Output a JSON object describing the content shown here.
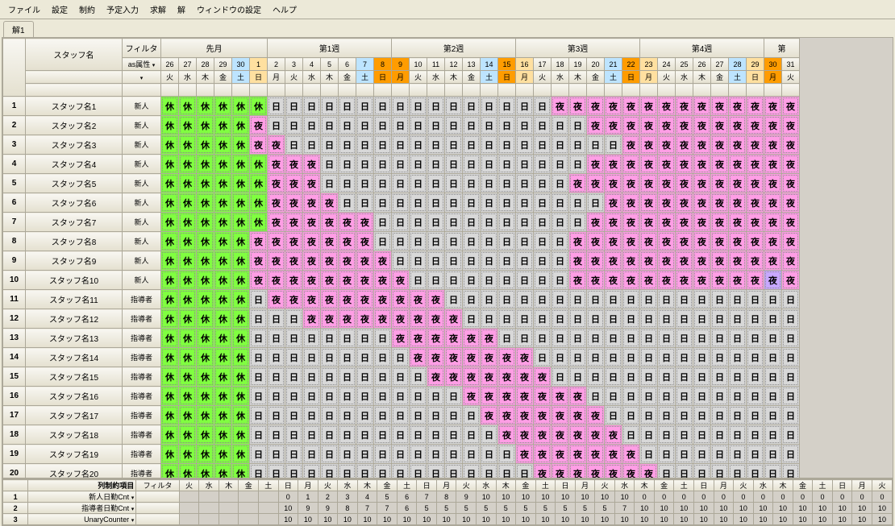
{
  "menu": [
    "ファイル",
    "設定",
    "制約",
    "予定入力",
    "求解",
    "解",
    "ウィンドウの設定",
    "ヘルプ"
  ],
  "tab_label": "解1",
  "col_staff": "スタッフ名",
  "col_filter": "フィルタ",
  "col_attr": "as属性",
  "weeks": [
    "先月",
    "第1週",
    "第2週",
    "第3週",
    "第4週",
    "第"
  ],
  "weekspans": [
    6,
    7,
    7,
    7,
    7,
    3
  ],
  "days": [
    "26",
    "27",
    "28",
    "29",
    "30",
    "1",
    "2",
    "3",
    "4",
    "5",
    "6",
    "7",
    "8",
    "9",
    "10",
    "11",
    "12",
    "13",
    "14",
    "15",
    "16",
    "17",
    "18",
    "19",
    "20",
    "21",
    "22",
    "23",
    "24",
    "25",
    "26",
    "27",
    "28",
    "29",
    "30",
    "31"
  ],
  "dow": [
    "火",
    "水",
    "木",
    "金",
    "土",
    "日",
    "月",
    "火",
    "水",
    "木",
    "金",
    "土",
    "日",
    "月",
    "火",
    "水",
    "木",
    "金",
    "土",
    "日",
    "月",
    "火",
    "水",
    "木",
    "金",
    "土",
    "日",
    "月",
    "火",
    "水",
    "木",
    "金",
    "土",
    "日",
    "月",
    "火"
  ],
  "dowc": [
    "",
    "",
    "",
    "",
    "sat",
    "sun",
    "",
    "",
    "",
    "",
    "",
    "sat",
    "or",
    "or",
    "",
    "",
    "",
    "",
    "sat",
    "or",
    "sun",
    "",
    "",
    "",
    "",
    "sat",
    "or",
    "sun",
    "",
    "",
    "",
    "",
    "sat",
    "sun",
    "or",
    ""
  ],
  "shift": {
    "h": "休",
    "n": "日",
    "y": "夜"
  },
  "staff": [
    {
      "name": "スタッフ名1",
      "attr": "新人",
      "r": "hhhhhhnnnnnnnnnnnnnnnnyyyyyyyyyyyyyy"
    },
    {
      "name": "スタッフ名2",
      "attr": "新人",
      "r": "hhhhhynnnnnnnnnnnnnnnnnnyyyyyyyyyyyy"
    },
    {
      "name": "スタッフ名3",
      "attr": "新人",
      "r": "hhhhhyynnnnnnnnnnnnnnnnnnnyyyyyyyyyy"
    },
    {
      "name": "スタッフ名4",
      "attr": "新人",
      "r": "hhhhhhyyynnnnnnnnnnnnnnnyyyyyyyyyyyy"
    },
    {
      "name": "スタッフ名5",
      "attr": "新人",
      "r": "hhhhhhyyynnnnnnnnnnnnnnyyyyyyyyyyyyy"
    },
    {
      "name": "スタッフ名6",
      "attr": "新人",
      "r": "hhhhhhyyyynnnnnnnnnnnnnnnyyyyyyyyyyy"
    },
    {
      "name": "スタッフ名7",
      "attr": "新人",
      "r": "hhhhhhyyyyyynnnnnnnnnnnnyyyyyyyyyyyy"
    },
    {
      "name": "スタッフ名8",
      "attr": "新人",
      "r": "hhhhhyyyyyyynnnnnnnnnnnyyyyyyyyyyyyy"
    },
    {
      "name": "スタッフ名9",
      "attr": "新人",
      "r": "hhhhhyyyyyyyynnnnnnnnnnyyyyyyyyyyyyy"
    },
    {
      "name": "スタッフ名10",
      "attr": "新人",
      "r": "hhhhhyyyyyyyyynnnnnnnnnyyyyyyyyyyysy"
    },
    {
      "name": "スタッフ名11",
      "attr": "指導者",
      "r": "hhhhhnyyyyyyyyyynnnnnnnnnnnnnnnnnnnn"
    },
    {
      "name": "スタッフ名12",
      "attr": "指導者",
      "r": "hhhhhnnnyyyyyyyyynnnnnnnnnnnnnnnnnnn"
    },
    {
      "name": "スタッフ名13",
      "attr": "指導者",
      "r": "hhhhhnnnnnnnnyyyyyynnnnnnnnnnnnnnnnn"
    },
    {
      "name": "スタッフ名14",
      "attr": "指導者",
      "r": "hhhhhnnnnnnnnnyyyyyyynnnnnnnnnnnnnnn"
    },
    {
      "name": "スタッフ名15",
      "attr": "指導者",
      "r": "hhhhhnnnnnnnnnnyyyyyyynnnnnnnnnnnnnn"
    },
    {
      "name": "スタッフ名16",
      "attr": "指導者",
      "r": "hhhhhnnnnnnnnnnnnyyyyyyynnnnnnnnnnnn"
    },
    {
      "name": "スタッフ名17",
      "attr": "指導者",
      "r": "hhhhhnnnnnnnnnnnnnyyyyyyynnnnnnnnnnn"
    },
    {
      "name": "スタッフ名18",
      "attr": "指導者",
      "r": "hhhhhnnnnnnnnnnnnnnyyyyyyynnnnnnnnnn"
    },
    {
      "name": "スタッフ名19",
      "attr": "指導者",
      "r": "hhhhhnnnnnnnnnnnnnnnyyyyyyynnnnnnnnn"
    },
    {
      "name": "スタッフ名20",
      "attr": "指導者",
      "r": "hhhhhnnnnnnnnnnnnnnnnyyyyyyynnnnnnnn"
    }
  ],
  "bottom_hdr": "列制約項目",
  "bottom_filter": "フィルタ",
  "bottom_dow": [
    "火",
    "水",
    "木",
    "金",
    "土",
    "日",
    "月",
    "火",
    "水",
    "木",
    "金",
    "土",
    "日",
    "月",
    "火",
    "水",
    "木",
    "金",
    "土",
    "日",
    "月",
    "火",
    "水",
    "木",
    "金",
    "土",
    "日",
    "月",
    "火",
    "水",
    "木",
    "金",
    "土",
    "日",
    "月",
    "火"
  ],
  "counters": [
    {
      "name": "新人日勤Cnt",
      "v": [
        "",
        "",
        "",
        "",
        "",
        "0",
        "1",
        "2",
        "3",
        "4",
        "5",
        "6",
        "7",
        "8",
        "9",
        "10",
        "10",
        "10",
        "10",
        "10",
        "10",
        "10",
        "10",
        "0",
        "0",
        "0",
        "0",
        "0",
        "0",
        "0",
        "0",
        "0",
        "0",
        "0",
        "0",
        "0"
      ]
    },
    {
      "name": "指導者日勤Cnt",
      "v": [
        "",
        "",
        "",
        "",
        "",
        "10",
        "9",
        "9",
        "8",
        "7",
        "7",
        "6",
        "5",
        "5",
        "5",
        "5",
        "5",
        "5",
        "5",
        "5",
        "5",
        "5",
        "7",
        "10",
        "10",
        "10",
        "10",
        "10",
        "10",
        "10",
        "10",
        "10",
        "10",
        "10",
        "10",
        "10"
      ]
    },
    {
      "name": "UnaryCounter",
      "v": [
        "",
        "",
        "",
        "",
        "",
        "10",
        "10",
        "10",
        "10",
        "10",
        "10",
        "10",
        "10",
        "10",
        "10",
        "10",
        "10",
        "10",
        "10",
        "10",
        "10",
        "10",
        "10",
        "10",
        "10",
        "10",
        "10",
        "10",
        "10",
        "10",
        "10",
        "10",
        "10",
        "10",
        "10",
        "10"
      ]
    }
  ]
}
